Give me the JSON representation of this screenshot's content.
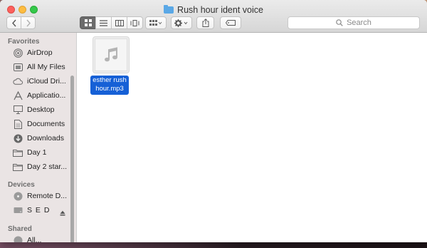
{
  "window": {
    "title": "Rush hour ident voice"
  },
  "toolbar": {
    "back_icon": "chevron-left-icon",
    "forward_icon": "chevron-right-icon",
    "view_modes": [
      "icon-view",
      "list-view",
      "column-view",
      "cover-flow-view"
    ],
    "active_view": "icon-view",
    "arrange_icon": "grid-arrange-icon",
    "action_icon": "gear-icon",
    "share_icon": "share-icon",
    "tag_icon": "tag-icon",
    "search_placeholder": "Search"
  },
  "sidebar": {
    "favorites_header": "Favorites",
    "favorites": [
      {
        "label": "AirDrop",
        "icon": "airdrop-icon"
      },
      {
        "label": "All My Files",
        "icon": "all-files-icon"
      },
      {
        "label": "iCloud Dri...",
        "icon": "cloud-icon"
      },
      {
        "label": "Applicatio...",
        "icon": "applications-icon"
      },
      {
        "label": "Desktop",
        "icon": "desktop-icon"
      },
      {
        "label": "Documents",
        "icon": "documents-icon"
      },
      {
        "label": "Downloads",
        "icon": "downloads-icon"
      },
      {
        "label": "Day 1",
        "icon": "folder-icon"
      },
      {
        "label": "Day 2 star...",
        "icon": "folder-icon"
      }
    ],
    "devices_header": "Devices",
    "devices": [
      {
        "label": "Remote D...",
        "icon": "disc-icon"
      },
      {
        "label": "S E D",
        "icon": "drive-icon",
        "eject": "eject-icon"
      }
    ],
    "shared_header": "Shared",
    "shared": [
      {
        "label": "All...",
        "icon": "network-icon"
      }
    ]
  },
  "files": [
    {
      "name": "esther rush hour.mp3",
      "line1": "esther rush",
      "line2": "hour.mp3",
      "icon": "music-note-icon",
      "selected": true
    }
  ],
  "colors": {
    "selection": "#1660d6",
    "close": "#fc605c",
    "minimize": "#fdbc40",
    "maximize": "#34c84a"
  }
}
